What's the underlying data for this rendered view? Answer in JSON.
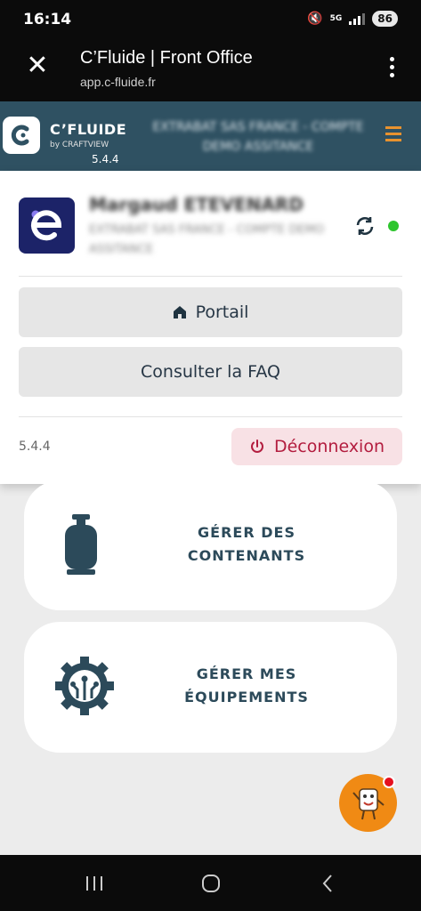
{
  "status_bar": {
    "time": "16:14",
    "network": "5G",
    "battery": "86"
  },
  "browser": {
    "title": "C’Fluide | Front Office",
    "url": "app.c-fluide.fr"
  },
  "header": {
    "brand": "C’FLUIDE",
    "brand_sub": "by CRAFTVIEW",
    "version": "5.4.4",
    "company_blurred": "EXTRABAT SAS FRANCE - COMPTE DEMO ASSITANCE"
  },
  "profile": {
    "user_name_blurred": "Margaud ETEVENARD",
    "user_company_blurred": "EXTRABAT SAS FRANCE - COMPTE DEMO ASSITANCE",
    "portal_label": "Portail",
    "faq_label": "Consulter la FAQ",
    "version": "5.4.4",
    "logout_label": "Déconnexion"
  },
  "menu": {
    "containers_line1": "GÉRER DES",
    "containers_line2": "CONTENANTS",
    "equipment_line1": "GÉRER MES",
    "equipment_line2": "ÉQUIPEMENTS"
  },
  "colors": {
    "header_bg": "#2f5162",
    "accent_orange": "#e8922e",
    "logout_text": "#b31d3f",
    "online": "#2ec52e",
    "icon_dark": "#2c4a5a"
  }
}
